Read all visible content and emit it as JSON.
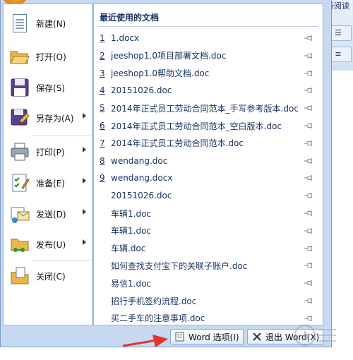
{
  "background": {
    "tab_text": "所阅读",
    "group1_glyph": "☰",
    "group2_glyph": "≡"
  },
  "menu": {
    "commands": [
      {
        "label": "新建(N)",
        "icon": "new-document-icon",
        "has_submenu": false
      },
      {
        "label": "打开(O)",
        "icon": "open-folder-icon",
        "has_submenu": false
      },
      {
        "label": "保存(S)",
        "icon": "save-disk-icon",
        "has_submenu": false
      },
      {
        "label": "另存为(A)",
        "icon": "save-as-icon",
        "has_submenu": true
      },
      {
        "label": "打印(P)",
        "icon": "printer-icon",
        "has_submenu": true
      },
      {
        "label": "准备(E)",
        "icon": "prepare-checklist-icon",
        "has_submenu": true
      },
      {
        "label": "发送(D)",
        "icon": "send-icon",
        "has_submenu": true
      },
      {
        "label": "发布(U)",
        "icon": "publish-folder-icon",
        "has_submenu": true
      },
      {
        "label": "关闭(C)",
        "icon": "close-folder-icon",
        "has_submenu": false
      }
    ],
    "recent": {
      "title": "最近使用的文档",
      "items": [
        {
          "num": "1",
          "name": "1.docx"
        },
        {
          "num": "2",
          "name": "jeeshop1.0项目部署文档.doc"
        },
        {
          "num": "3",
          "name": "jeeshop1.0帮助文档.doc"
        },
        {
          "num": "4",
          "name": "20151026.doc"
        },
        {
          "num": "5",
          "name": "2014年正式员工劳动合同范本_手写参考版本.doc"
        },
        {
          "num": "6",
          "name": "2014年正式员工劳动合同范本_空白版本.doc"
        },
        {
          "num": "7",
          "name": "2014年正式员工劳动合同范本.doc"
        },
        {
          "num": "8",
          "name": "wendang.doc"
        },
        {
          "num": "9",
          "name": "wendang.docx"
        },
        {
          "num": "",
          "name": "20151026.doc"
        },
        {
          "num": "",
          "name": "车辆1.doc"
        },
        {
          "num": "",
          "name": "车辆1.doc"
        },
        {
          "num": "",
          "name": "车辆.doc"
        },
        {
          "num": "",
          "name": "如何查找支付宝下的关联子账户.doc"
        },
        {
          "num": "",
          "name": "易信1.doc"
        },
        {
          "num": "",
          "name": "招行手机签约流程.doc"
        },
        {
          "num": "",
          "name": "买二手车的注意事项.doc"
        }
      ]
    },
    "buttons": {
      "word_options": "Word 选项(I)",
      "exit_word": "退出 Word(X)"
    }
  },
  "colors": {
    "menu_bg": "#c6d9f1",
    "accent_text": "#15305f",
    "annotation_arrow": "#e8322a"
  }
}
